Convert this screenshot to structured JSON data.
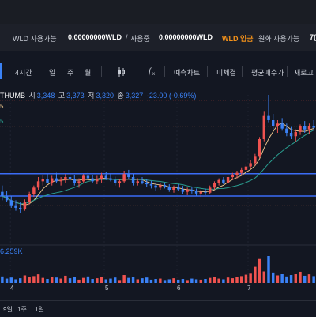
{
  "balance": {
    "coin_label": "WLD 사용가능",
    "coin_value": "0.00000000WLD",
    "sep": "/",
    "in_use_label": "사용중",
    "in_use_value": "0.00000000WLD",
    "deposit_label": "WLD 입금",
    "krw_label": "원화 사용가능",
    "krw_value": "7("
  },
  "toolbar": {
    "interval": "4시간",
    "day": "일",
    "week": "주",
    "month": "월",
    "candle_icon": "candlestick-icon",
    "fx_icon": "fx-icon",
    "fx_label": "f",
    "indicator": "예측차트",
    "unfilled": "미체결",
    "avg_price": "평균매수가",
    "refresh": "새로고"
  },
  "ohlc": {
    "exchange": "THUMB",
    "open_label": "시",
    "open": "3,348",
    "high_label": "고",
    "high": "3,373",
    "low_label": "저",
    "low": "3,320",
    "close_label": "종",
    "close": "3,327",
    "change": "-23.00 (-0.69%)"
  },
  "ma_labels": [
    "5",
    "5"
  ],
  "volume": {
    "value": "6.259K"
  },
  "xaxis": {
    "labels": [
      "4",
      "5",
      "6",
      "7"
    ]
  },
  "bottom": {
    "items": [
      "9일",
      "1주",
      "1일"
    ]
  },
  "colors": {
    "up": "#ef5350",
    "down": "#3b82f6",
    "ma_short": "#e8c28a",
    "ma_long": "#2a9d8f"
  },
  "chart_data": {
    "type": "candlestick",
    "candles": [
      [
        3330,
        3345,
        3310,
        3320
      ],
      [
        3320,
        3332,
        3305,
        3310
      ],
      [
        3310,
        3320,
        3292,
        3298
      ],
      [
        3298,
        3310,
        3285,
        3292
      ],
      [
        3292,
        3305,
        3280,
        3288
      ],
      [
        3288,
        3312,
        3285,
        3305
      ],
      [
        3305,
        3330,
        3300,
        3325
      ],
      [
        3325,
        3345,
        3318,
        3340
      ],
      [
        3340,
        3365,
        3335,
        3355
      ],
      [
        3355,
        3370,
        3345,
        3360
      ],
      [
        3360,
        3372,
        3350,
        3352
      ],
      [
        3352,
        3368,
        3345,
        3362
      ],
      [
        3362,
        3375,
        3350,
        3355
      ],
      [
        3355,
        3365,
        3345,
        3358
      ],
      [
        3358,
        3372,
        3352,
        3365
      ],
      [
        3365,
        3375,
        3355,
        3360
      ],
      [
        3360,
        3370,
        3345,
        3350
      ],
      [
        3350,
        3362,
        3340,
        3355
      ],
      [
        3355,
        3372,
        3350,
        3368
      ],
      [
        3368,
        3378,
        3358,
        3362
      ],
      [
        3362,
        3370,
        3350,
        3355
      ],
      [
        3355,
        3368,
        3348,
        3360
      ],
      [
        3360,
        3375,
        3352,
        3368
      ],
      [
        3368,
        3378,
        3358,
        3362
      ],
      [
        3362,
        3372,
        3355,
        3358
      ],
      [
        3358,
        3366,
        3345,
        3350
      ],
      [
        3350,
        3360,
        3340,
        3355
      ],
      [
        3355,
        3380,
        3350,
        3372
      ],
      [
        3372,
        3382,
        3360,
        3365
      ],
      [
        3365,
        3372,
        3345,
        3350
      ],
      [
        3350,
        3362,
        3345,
        3355
      ],
      [
        3355,
        3365,
        3348,
        3352
      ],
      [
        3352,
        3360,
        3342,
        3348
      ],
      [
        3348,
        3356,
        3338,
        3345
      ],
      [
        3345,
        3352,
        3332,
        3340
      ],
      [
        3340,
        3350,
        3335,
        3346
      ],
      [
        3346,
        3352,
        3338,
        3342
      ],
      [
        3342,
        3348,
        3330,
        3335
      ],
      [
        3335,
        3345,
        3328,
        3340
      ],
      [
        3340,
        3348,
        3332,
        3336
      ],
      [
        3336,
        3344,
        3325,
        3330
      ],
      [
        3330,
        3340,
        3322,
        3335
      ],
      [
        3335,
        3342,
        3326,
        3332
      ],
      [
        3332,
        3338,
        3320,
        3326
      ],
      [
        3326,
        3335,
        3318,
        3330
      ],
      [
        3330,
        3338,
        3322,
        3328
      ],
      [
        3328,
        3345,
        3325,
        3340
      ],
      [
        3340,
        3355,
        3335,
        3350
      ],
      [
        3350,
        3362,
        3345,
        3358
      ],
      [
        3358,
        3365,
        3348,
        3352
      ],
      [
        3352,
        3368,
        3350,
        3365
      ],
      [
        3365,
        3375,
        3358,
        3370
      ],
      [
        3370,
        3380,
        3362,
        3375
      ],
      [
        3375,
        3388,
        3370,
        3382
      ],
      [
        3382,
        3395,
        3375,
        3390
      ],
      [
        3390,
        3405,
        3385,
        3398
      ],
      [
        3398,
        3420,
        3392,
        3415
      ],
      [
        3415,
        3460,
        3410,
        3455
      ],
      [
        3455,
        3520,
        3450,
        3510
      ],
      [
        3510,
        3565,
        3495,
        3500
      ],
      [
        3500,
        3515,
        3478,
        3485
      ],
      [
        3485,
        3500,
        3470,
        3492
      ],
      [
        3492,
        3505,
        3475,
        3480
      ],
      [
        3480,
        3492,
        3462,
        3470
      ],
      [
        3470,
        3484,
        3455,
        3462
      ],
      [
        3462,
        3478,
        3450,
        3472
      ],
      [
        3472,
        3490,
        3465,
        3485
      ],
      [
        3485,
        3498,
        3470,
        3478
      ],
      [
        3478,
        3492,
        3468,
        3486
      ],
      [
        3486,
        3500,
        3475,
        3482
      ]
    ],
    "volumes": [
      1.8,
      1.2,
      1.5,
      1.0,
      1.3,
      2.1,
      1.6,
      1.9,
      2.4,
      1.4,
      1.1,
      1.7,
      1.5,
      1.2,
      2.0,
      1.3,
      1.6,
      0.9,
      1.4,
      1.8,
      1.1,
      1.3,
      1.7,
      1.0,
      1.2,
      1.5,
      0.8,
      2.2,
      1.4,
      1.6,
      1.0,
      1.3,
      1.5,
      0.9,
      1.1,
      1.2,
      0.8,
      1.0,
      1.3,
      0.9,
      1.1,
      0.8,
      1.2,
      1.0,
      0.9,
      1.1,
      1.4,
      1.6,
      1.2,
      1.0,
      1.5,
      1.3,
      1.7,
      1.9,
      2.3,
      2.8,
      4.5,
      6.9,
      3.2,
      7.5,
      2.9,
      2.1,
      2.6,
      1.8,
      2.2,
      2.5,
      3.1,
      2.0,
      2.4,
      1.9
    ],
    "levels": [
      3373,
      3320
    ],
    "ylim": [
      3260,
      3560
    ],
    "day_markers": [
      "4",
      "5",
      "6",
      "7"
    ]
  }
}
